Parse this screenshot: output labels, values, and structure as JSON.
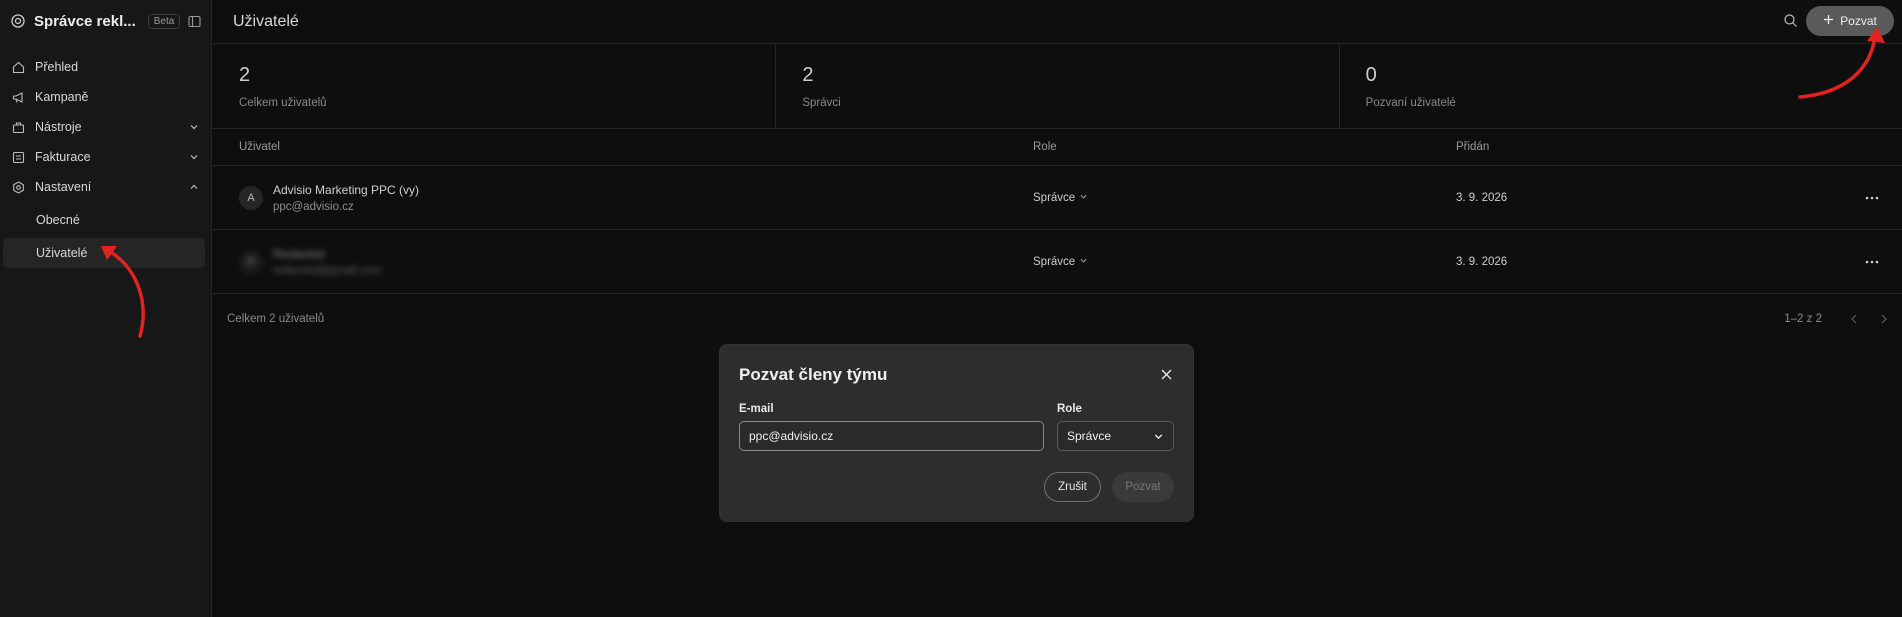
{
  "sidebar": {
    "brand": "Správce rekl...",
    "badge": "Beta",
    "items": [
      {
        "label": "Přehled"
      },
      {
        "label": "Kampaně"
      },
      {
        "label": "Nástroje"
      },
      {
        "label": "Fakturace"
      },
      {
        "label": "Nastavení"
      }
    ],
    "subitems": [
      {
        "label": "Obecné"
      },
      {
        "label": "Uživatelé"
      }
    ]
  },
  "header": {
    "title": "Uživatelé",
    "invite_label": "Pozvat"
  },
  "stats": [
    {
      "value": "2",
      "label": "Celkem uživatelů"
    },
    {
      "value": "2",
      "label": "Správci"
    },
    {
      "value": "0",
      "label": "Pozvaní uživatelé"
    }
  ],
  "table": {
    "columns": [
      "Uživatel",
      "Role",
      "Přidán"
    ],
    "rows": [
      {
        "avatar": "A",
        "name": "Advisio Marketing PPC (vy)",
        "email": "ppc@advisio.cz",
        "role": "Správce",
        "added": "3. 9. 2026"
      },
      {
        "avatar": "R",
        "name": "Redacted",
        "email": "redacted@gmail.com",
        "role": "Správce",
        "added": "3. 9. 2026"
      }
    ],
    "footer_total": "Celkem 2 uživatelů",
    "range": "1–2 z 2"
  },
  "modal": {
    "title": "Pozvat členy týmu",
    "email_label": "E-mail",
    "email_value": "ppc@advisio.cz",
    "role_label": "Role",
    "role_value": "Správce",
    "cancel_label": "Zrušit",
    "invite_label": "Pozvat"
  },
  "colors": {
    "accent_arrow": "#e32222",
    "background": "#0e0e0e",
    "sidebar": "#171717",
    "modal": "#2d2d2d"
  }
}
